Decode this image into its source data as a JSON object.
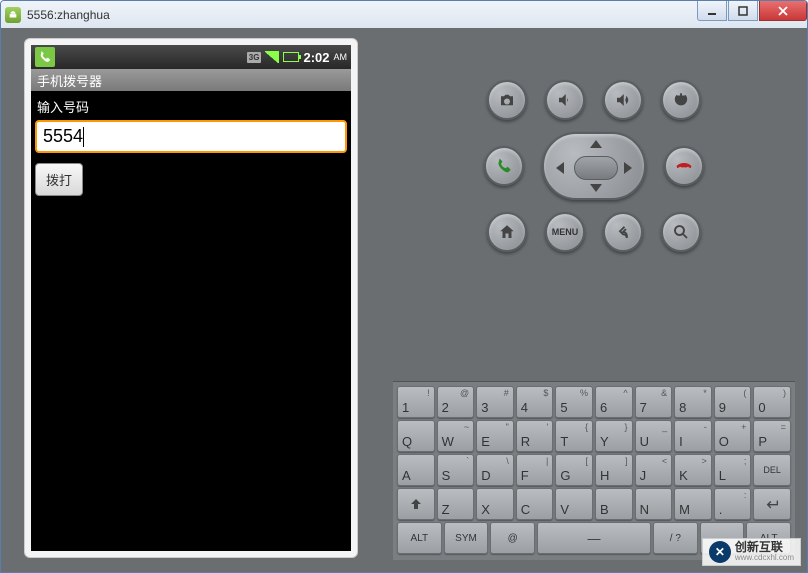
{
  "window": {
    "title": "5556:zhanghua"
  },
  "statusbar": {
    "network": "3G",
    "time": "2:02",
    "ampm": "AM"
  },
  "app": {
    "title": "手机拨号器",
    "input_label": "输入号码",
    "input_value": "5554",
    "dial_button": "拨打"
  },
  "hw": {
    "menu_label": "MENU"
  },
  "keys": {
    "row1": [
      {
        "m": "1",
        "s": "!"
      },
      {
        "m": "2",
        "s": "@"
      },
      {
        "m": "3",
        "s": "#"
      },
      {
        "m": "4",
        "s": "$"
      },
      {
        "m": "5",
        "s": "%"
      },
      {
        "m": "6",
        "s": "^"
      },
      {
        "m": "7",
        "s": "&"
      },
      {
        "m": "8",
        "s": "*"
      },
      {
        "m": "9",
        "s": "("
      },
      {
        "m": "0",
        "s": ")"
      }
    ],
    "row2": [
      {
        "m": "Q",
        "s": ""
      },
      {
        "m": "W",
        "s": "~"
      },
      {
        "m": "E",
        "s": "\""
      },
      {
        "m": "R",
        "s": "'"
      },
      {
        "m": "T",
        "s": "{"
      },
      {
        "m": "Y",
        "s": "}"
      },
      {
        "m": "U",
        "s": "_"
      },
      {
        "m": "I",
        "s": "-"
      },
      {
        "m": "O",
        "s": "+"
      },
      {
        "m": "P",
        "s": "="
      }
    ],
    "row3": [
      {
        "m": "A",
        "s": ""
      },
      {
        "m": "S",
        "s": "`"
      },
      {
        "m": "D",
        "s": "\\"
      },
      {
        "m": "F",
        "s": "|"
      },
      {
        "m": "G",
        "s": "["
      },
      {
        "m": "H",
        "s": "]"
      },
      {
        "m": "J",
        "s": "<"
      },
      {
        "m": "K",
        "s": ">"
      },
      {
        "m": "L",
        "s": ";"
      }
    ],
    "del": "DEL",
    "row4": [
      {
        "m": "Z",
        "s": ""
      },
      {
        "m": "X",
        "s": ""
      },
      {
        "m": "C",
        "s": ""
      },
      {
        "m": "V",
        "s": ""
      },
      {
        "m": "B",
        "s": ""
      },
      {
        "m": "N",
        "s": ""
      },
      {
        "m": "M",
        "s": ""
      },
      {
        "m": ".",
        "s": ":"
      },
      {
        "m": "",
        "s": ""
      }
    ],
    "alt": "ALT",
    "sym": "SYM",
    "at": "@",
    "slash": "/",
    "comma": ",",
    "qmark": "?"
  },
  "watermark": {
    "cn": "创新互联",
    "url": "www.cdcxhl.com"
  }
}
